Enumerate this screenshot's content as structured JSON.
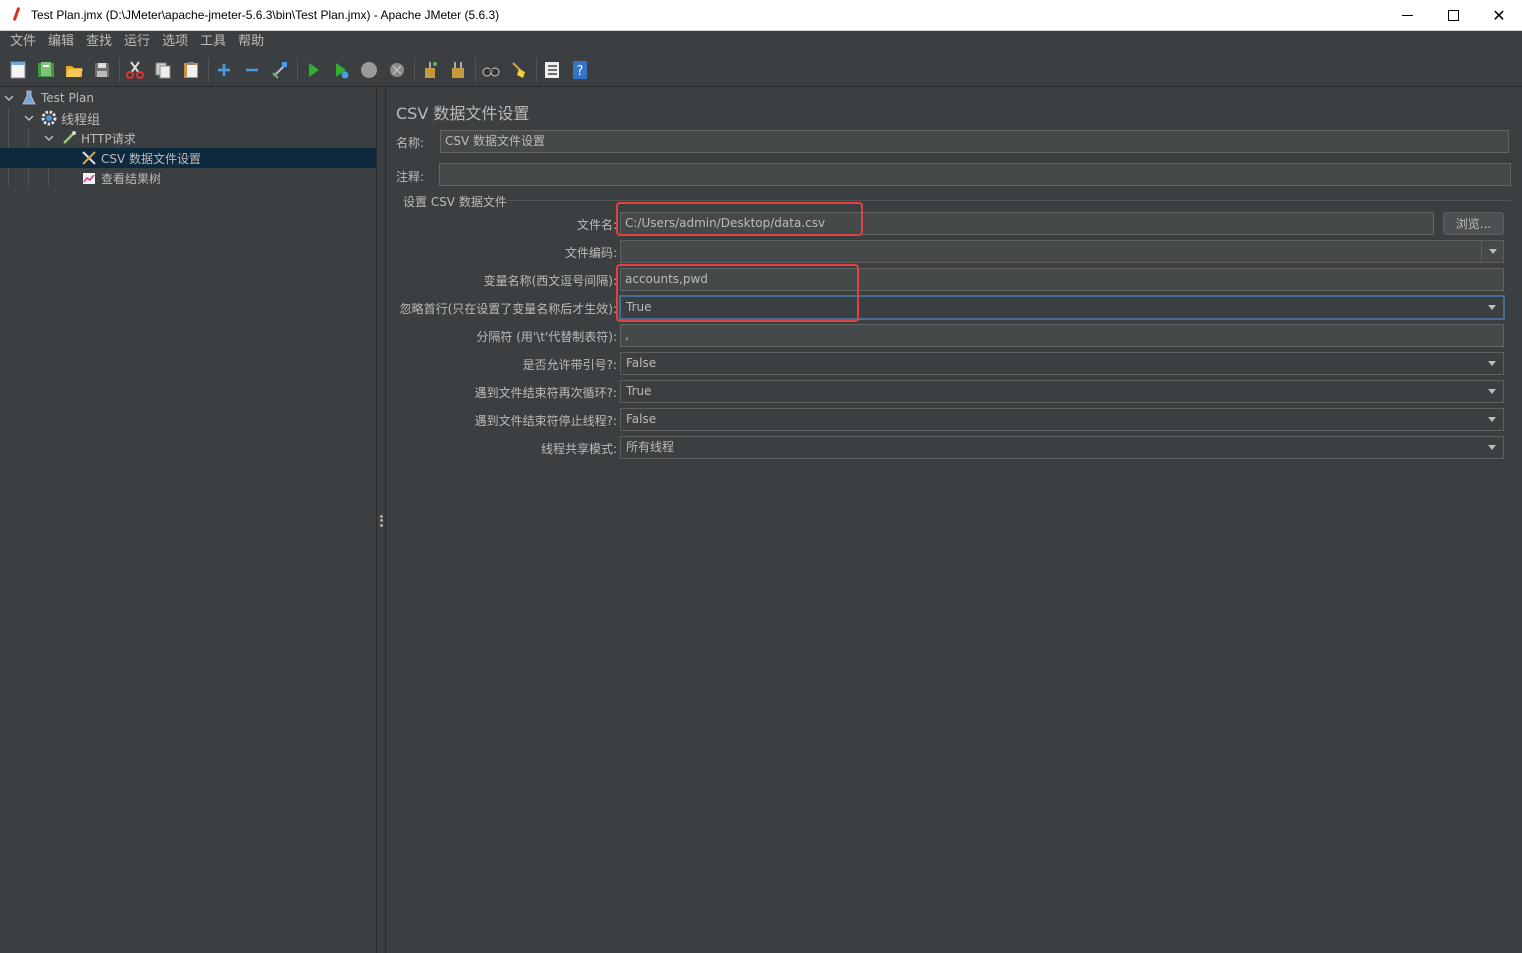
{
  "window": {
    "title": "Test Plan.jmx (D:\\JMeter\\apache-jmeter-5.6.3\\bin\\Test Plan.jmx) - Apache JMeter (5.6.3)",
    "minimize": "",
    "maximize": "",
    "close": "✕"
  },
  "menu": [
    "文件",
    "编辑",
    "查找",
    "运行",
    "选项",
    "工具",
    "帮助"
  ],
  "toolbar": {
    "icons": [
      "new-icon",
      "templates-icon",
      "open-icon",
      "save-icon",
      "cut-icon",
      "copy-icon",
      "paste-icon",
      "expand-icon",
      "collapse-icon",
      "toggle-icon",
      "start-icon",
      "start-no-pause-icon",
      "stop-icon",
      "shutdown-icon",
      "clear-icon",
      "clear-all-icon",
      "search-icon",
      "reset-search-icon",
      "function-helper-icon",
      "help-icon"
    ]
  },
  "tree": {
    "items": [
      {
        "label": "Test Plan",
        "icon": "flask-icon"
      },
      {
        "label": "线程组",
        "icon": "gear-icon"
      },
      {
        "label": "HTTP请求",
        "icon": "pipette-icon"
      },
      {
        "label": "CSV 数据文件设置",
        "icon": "tools-icon"
      },
      {
        "label": "查看结果树",
        "icon": "chart-icon"
      }
    ]
  },
  "panel": {
    "title": "CSV 数据文件设置",
    "name_label": "名称:",
    "name_value": "CSV 数据文件设置",
    "comment_label": "注释:",
    "comment_value": "",
    "group_title": "设置 CSV 数据文件",
    "filename_label": "文件名:",
    "filename_value": "C:/Users/admin/Desktop/data.csv",
    "browse_button": "浏览...",
    "encoding_label": "文件编码:",
    "encoding_value": "",
    "varnames_label": "变量名称(西文逗号间隔):",
    "varnames_value": "accounts,pwd",
    "ignore_first_label": "忽略首行(只在设置了变量名称后才生效):",
    "ignore_first_value": "True",
    "delimiter_label": "分隔符 (用'\\t'代替制表符):",
    "delimiter_value": ",",
    "quoted_label": "是否允许带引号?:",
    "quoted_value": "False",
    "recycle_label": "遇到文件结束符再次循环?:",
    "recycle_value": "True",
    "stop_thread_label": "遇到文件结束符停止线程?:",
    "stop_thread_value": "False",
    "sharing_label": "线程共享模式:",
    "sharing_value": "所有线程"
  },
  "colors": {
    "background": "#3c3f41",
    "selection": "#0d293e",
    "highlight": "#e0423f",
    "focus": "#466d94"
  }
}
